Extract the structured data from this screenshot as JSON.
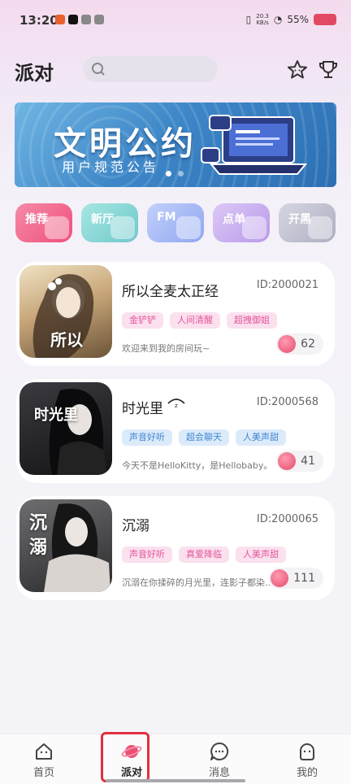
{
  "status_bar": {
    "time": "13:20",
    "net_top": "20.3",
    "net_bottom": "KB/s",
    "battery": "55%"
  },
  "header": {
    "logo": "派对"
  },
  "banner": {
    "title": "文明公约",
    "subtitle": "用户规范公告"
  },
  "chips": [
    {
      "label": "推荐",
      "color": "#f25a86"
    },
    {
      "label": "新厅",
      "color": "#7fd2cf"
    },
    {
      "label": "FM",
      "color": "#9fb2f4"
    },
    {
      "label": "点单",
      "color": "#c7a9ef"
    },
    {
      "label": "开黑",
      "color": "#b8b8cc"
    }
  ],
  "rooms": [
    {
      "name": "所以全麦太正经",
      "id": "ID:2000021",
      "cover_text": "所以",
      "tags": [
        {
          "label": "金铲铲",
          "style": "pink"
        },
        {
          "label": "人间清醒",
          "style": "pink"
        },
        {
          "label": "超拽御姐",
          "style": "pink"
        }
      ],
      "desc": "欢迎来到我的房间玩~",
      "count": "62"
    },
    {
      "name": "时光里",
      "id": "ID:2000568",
      "cover_text": "时光里",
      "tags": [
        {
          "label": "声音好听",
          "style": "blue"
        },
        {
          "label": "超会聊天",
          "style": "blue"
        },
        {
          "label": "人美声甜",
          "style": "blue"
        }
      ],
      "desc": "今天不是HelloKitty，是Hellobaby。",
      "count": "41"
    },
    {
      "name": "沉溺",
      "id": "ID:2000065",
      "cover_text": "沉溺",
      "tags": [
        {
          "label": "声音好听",
          "style": "pink"
        },
        {
          "label": "真爱降临",
          "style": "pink"
        },
        {
          "label": "人美声甜",
          "style": "pink"
        }
      ],
      "desc": "沉溺在你揉碎的月光里，连影子都染...",
      "count": "111"
    }
  ],
  "tabbar": {
    "home": "首页",
    "party": "派对",
    "messages": "消息",
    "mine": "我的"
  }
}
